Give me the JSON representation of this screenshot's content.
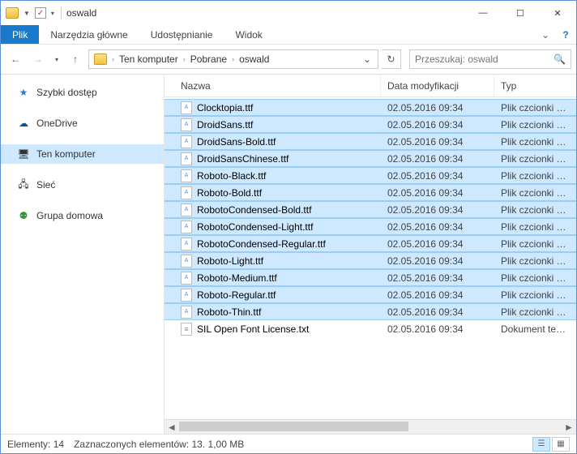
{
  "window": {
    "title": "oswald"
  },
  "ribbon": {
    "file": "Plik",
    "tabs": [
      "Narzędzia główne",
      "Udostępnianie",
      "Widok"
    ]
  },
  "breadcrumbs": [
    "Ten komputer",
    "Pobrane",
    "oswald"
  ],
  "search": {
    "placeholder": "Przeszukaj: oswald"
  },
  "sidebar": {
    "items": [
      {
        "label": "Szybki dostęp",
        "icon": "star",
        "selected": false
      },
      {
        "label": "OneDrive",
        "icon": "cloud",
        "selected": false
      },
      {
        "label": "Ten komputer",
        "icon": "pc",
        "selected": true
      },
      {
        "label": "Sieć",
        "icon": "net",
        "selected": false
      },
      {
        "label": "Grupa domowa",
        "icon": "home",
        "selected": false
      }
    ]
  },
  "columns": {
    "name": "Nazwa",
    "date": "Data modyfikacji",
    "type": "Typ"
  },
  "files": [
    {
      "name": "Clocktopia.ttf",
      "date": "02.05.2016 09:34",
      "type": "Plik czcionki True ...",
      "icon": "font",
      "selected": true
    },
    {
      "name": "DroidSans.ttf",
      "date": "02.05.2016 09:34",
      "type": "Plik czcionki True ...",
      "icon": "font",
      "selected": true
    },
    {
      "name": "DroidSans-Bold.ttf",
      "date": "02.05.2016 09:34",
      "type": "Plik czcionki True ...",
      "icon": "font",
      "selected": true
    },
    {
      "name": "DroidSansChinese.ttf",
      "date": "02.05.2016 09:34",
      "type": "Plik czcionki True ...",
      "icon": "font",
      "selected": true
    },
    {
      "name": "Roboto-Black.ttf",
      "date": "02.05.2016 09:34",
      "type": "Plik czcionki True ...",
      "icon": "font",
      "selected": true
    },
    {
      "name": "Roboto-Bold.ttf",
      "date": "02.05.2016 09:34",
      "type": "Plik czcionki True ...",
      "icon": "font",
      "selected": true
    },
    {
      "name": "RobotoCondensed-Bold.ttf",
      "date": "02.05.2016 09:34",
      "type": "Plik czcionki True ...",
      "icon": "font",
      "selected": true
    },
    {
      "name": "RobotoCondensed-Light.ttf",
      "date": "02.05.2016 09:34",
      "type": "Plik czcionki True ...",
      "icon": "font",
      "selected": true
    },
    {
      "name": "RobotoCondensed-Regular.ttf",
      "date": "02.05.2016 09:34",
      "type": "Plik czcionki True ...",
      "icon": "font",
      "selected": true
    },
    {
      "name": "Roboto-Light.ttf",
      "date": "02.05.2016 09:34",
      "type": "Plik czcionki True ...",
      "icon": "font",
      "selected": true
    },
    {
      "name": "Roboto-Medium.ttf",
      "date": "02.05.2016 09:34",
      "type": "Plik czcionki True ...",
      "icon": "font",
      "selected": true
    },
    {
      "name": "Roboto-Regular.ttf",
      "date": "02.05.2016 09:34",
      "type": "Plik czcionki True ...",
      "icon": "font",
      "selected": true
    },
    {
      "name": "Roboto-Thin.ttf",
      "date": "02.05.2016 09:34",
      "type": "Plik czcionki True ...",
      "icon": "font",
      "selected": true
    },
    {
      "name": "SIL Open Font License.txt",
      "date": "02.05.2016 09:34",
      "type": "Dokument tekstowy",
      "icon": "txt",
      "selected": false
    }
  ],
  "status": {
    "count_label": "Elementy:",
    "count": "14",
    "selection_label": "Zaznaczonych elementów:",
    "selection_count": "13.",
    "size": "1,00 MB"
  }
}
